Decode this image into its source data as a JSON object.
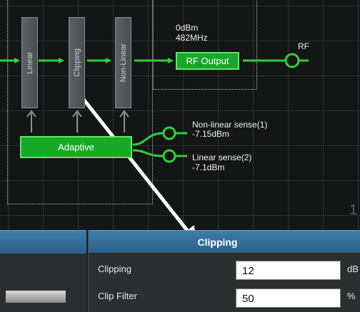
{
  "diagram": {
    "stages": [
      {
        "name": "linear",
        "label": "Linear"
      },
      {
        "name": "clipping",
        "label": "Clipping"
      },
      {
        "name": "nonlinear",
        "label": "Non-Linear"
      }
    ],
    "adaptive_label": "Adaptive",
    "rf_output_label": "RF Output",
    "output_power": "0dBm",
    "output_freq": "482MHz",
    "rf_label": "RF",
    "sense1_name": "Non-linear sense(1)",
    "sense1_value": "-7.15dBm",
    "sense2_name": "Linear sense(2)",
    "sense2_value": "-7.1dBm",
    "edge_number": "1",
    "colors": {
      "block_green": "#18a829",
      "wire_green": "#2fd13a",
      "arrow": "#ffffff"
    }
  },
  "panel": {
    "title": "Clipping",
    "rows": [
      {
        "label": "Clipping",
        "value": "12",
        "unit": "dB"
      },
      {
        "label": "Clip Filter",
        "value": "50",
        "unit": "%"
      }
    ]
  }
}
